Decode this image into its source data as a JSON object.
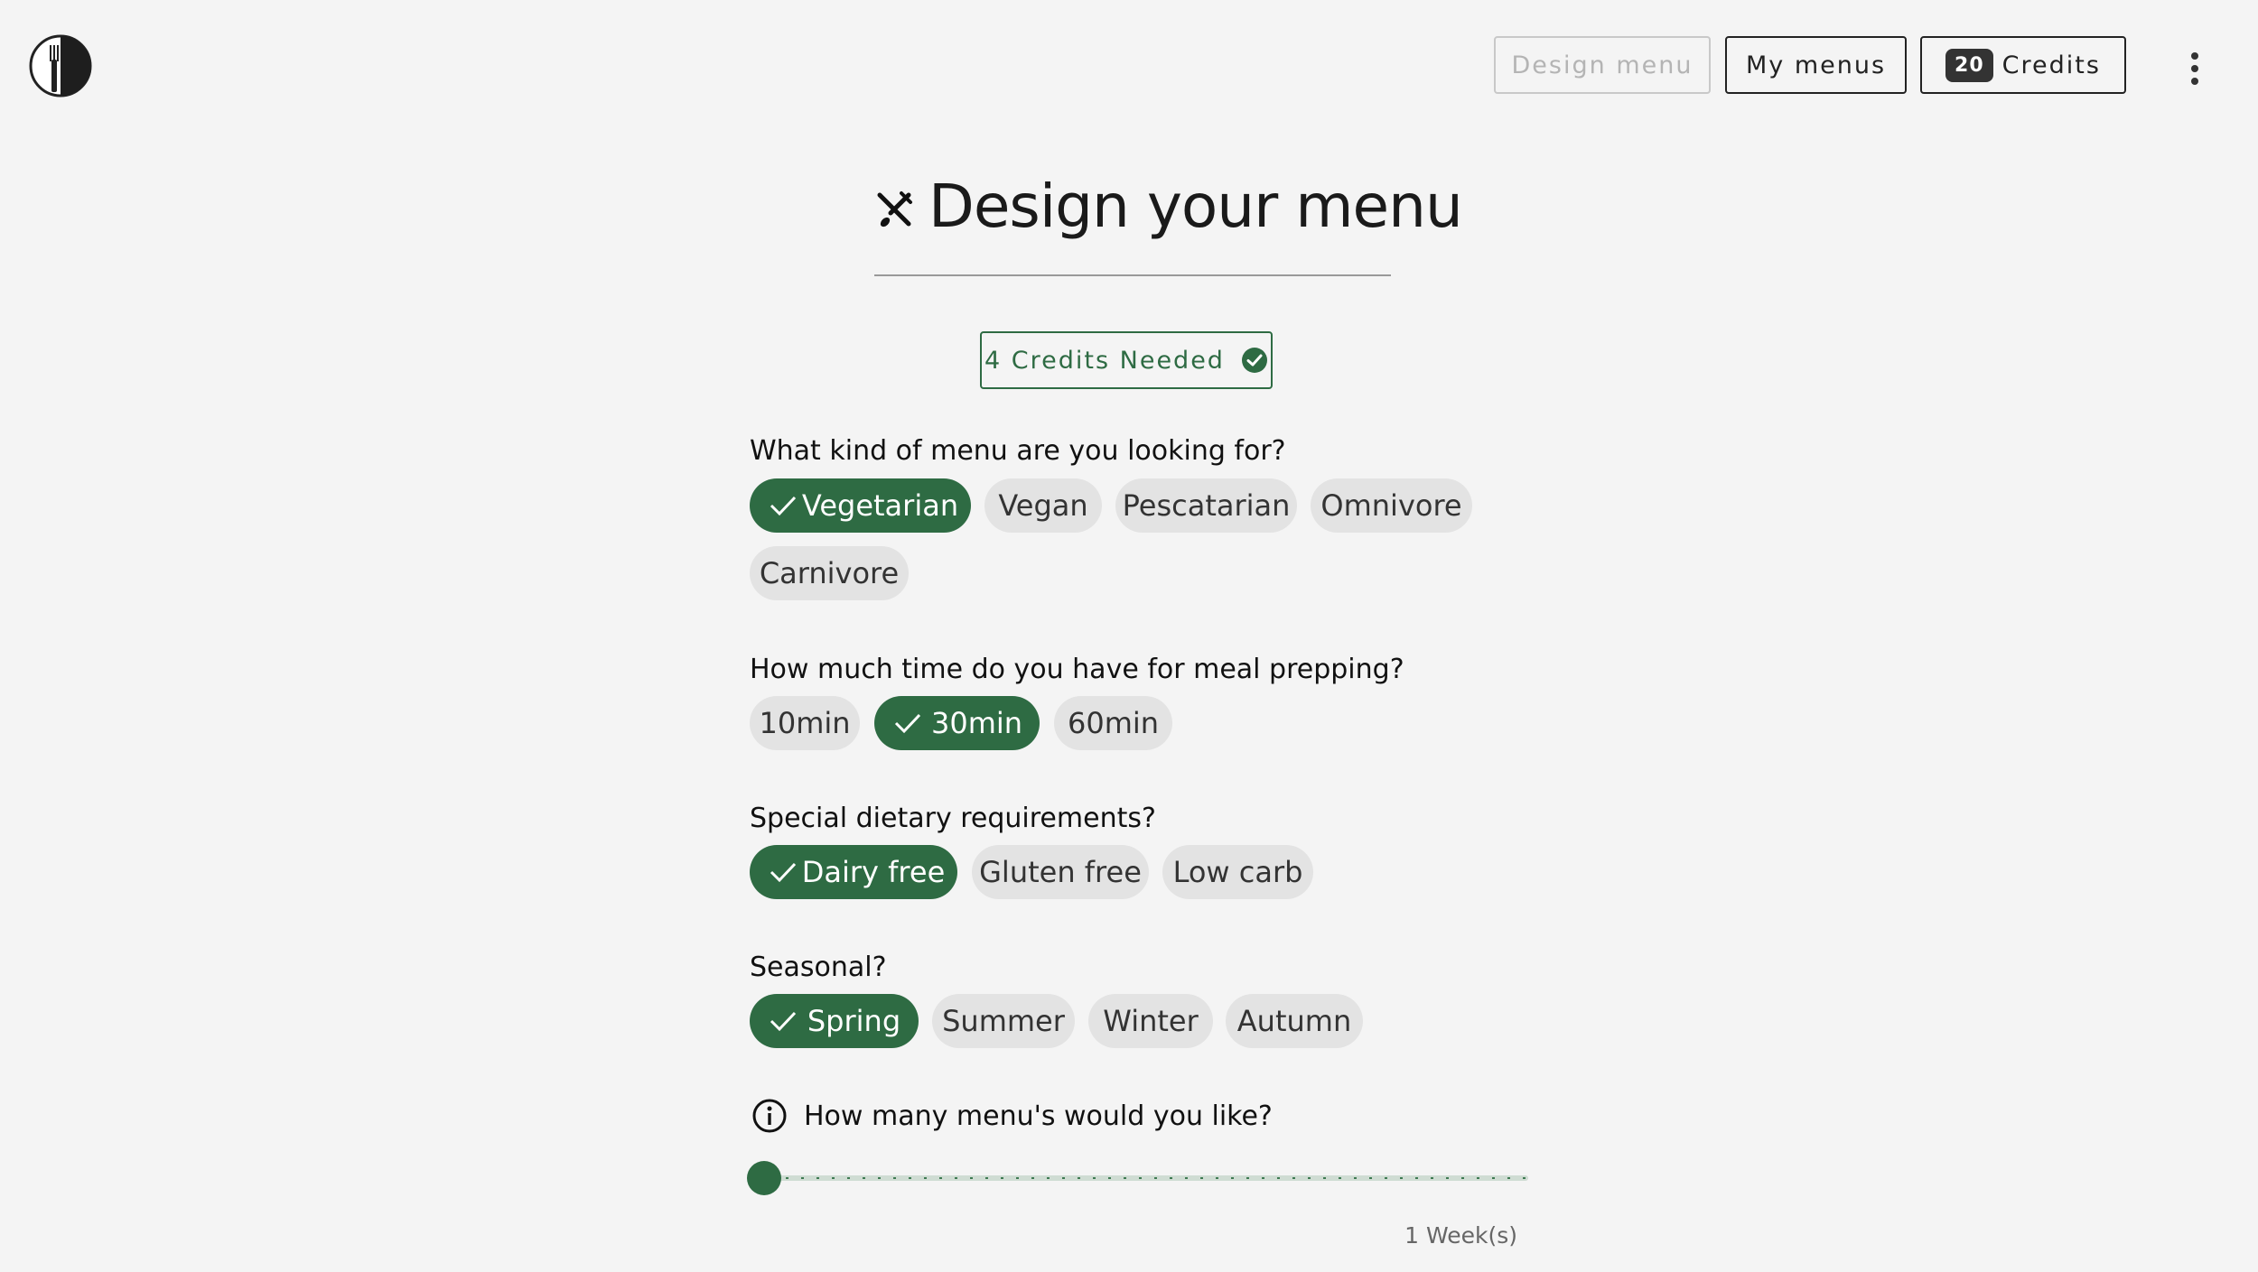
{
  "header": {
    "nav": {
      "design_menu": "Design menu",
      "my_menus": "My menus",
      "credits_count": "20",
      "credits_label": "Credits"
    }
  },
  "main": {
    "title": "Design your menu",
    "credits_needed": "4 Credits Needed",
    "menu_type": {
      "question": "What kind of menu are you looking for?",
      "options": [
        "Vegetarian",
        "Vegan",
        "Pescatarian",
        "Omnivore",
        "Carnivore"
      ],
      "selected": "Vegetarian"
    },
    "prep_time": {
      "question": "How much time do you have for meal prepping?",
      "options": [
        "10min",
        "30min",
        "60min"
      ],
      "selected": "30min"
    },
    "dietary": {
      "question": "Special dietary requirements?",
      "options": [
        "Dairy free",
        "Gluten free",
        "Low carb"
      ],
      "selected": "Dairy free"
    },
    "seasonal": {
      "question": "Seasonal?",
      "options": [
        "Spring",
        "Summer",
        "Winter",
        "Autumn"
      ],
      "selected": "Spring"
    },
    "menu_count": {
      "question": "How many menu's would you like?",
      "value_label": "1 Week(s)",
      "slider_fraction": 0
    }
  },
  "colors": {
    "accent": "#2e6b43",
    "chip_bg": "#e3e3e3",
    "page_bg": "#f4f4f4"
  },
  "icons": [
    "logo-icon",
    "cutlery-icon",
    "check-circle-icon",
    "check-icon",
    "info-icon",
    "kebab-menu-icon"
  ]
}
